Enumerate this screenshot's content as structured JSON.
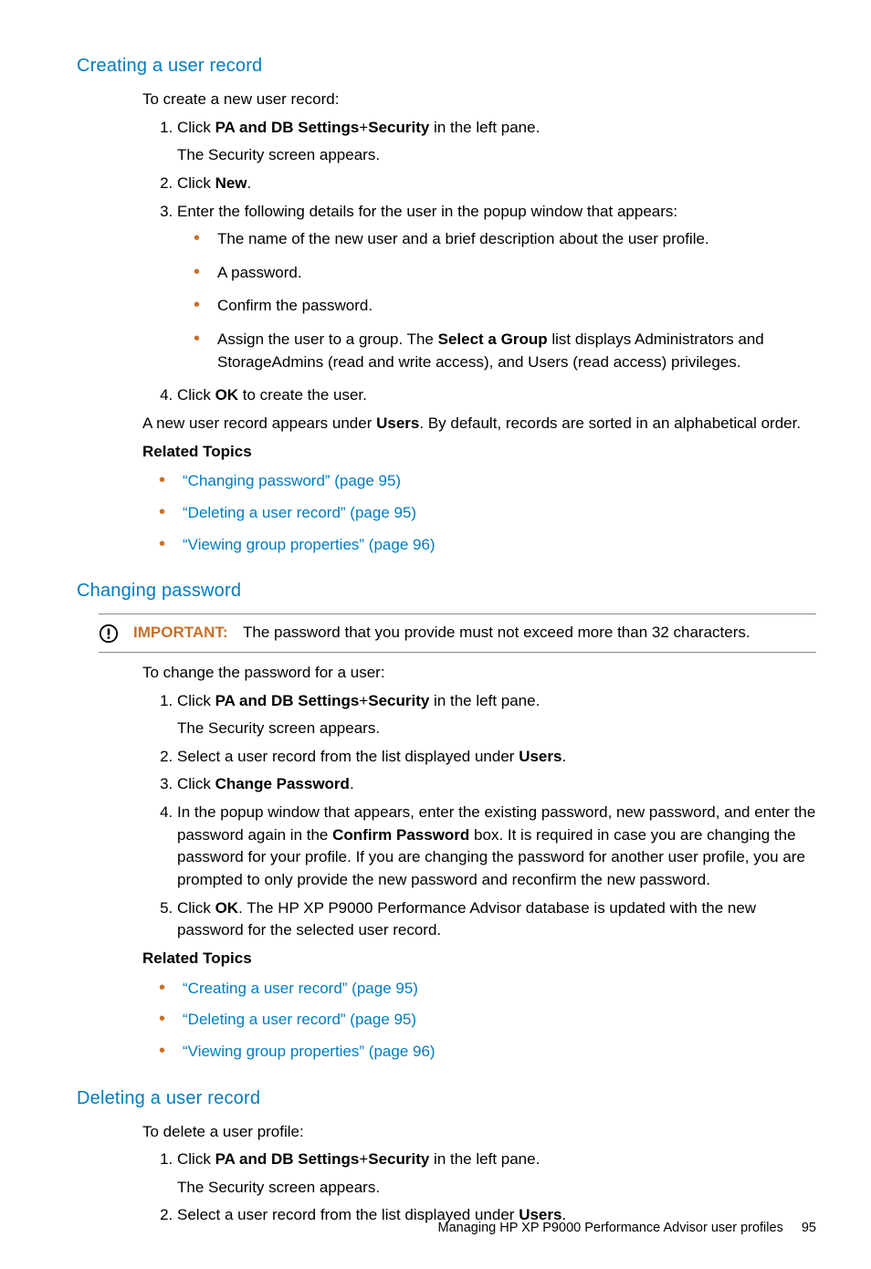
{
  "footer": {
    "text": "Managing HP XP P9000 Performance Advisor user profiles",
    "page": "95"
  },
  "sections": {
    "creating": {
      "heading": "Creating a user record",
      "intro": "To create a new user record:",
      "step1_a": "Click ",
      "step1_b": "PA and DB Settings",
      "step1_c": "+",
      "step1_d": "Security",
      "step1_e": " in the left pane.",
      "step1_sub": "The Security screen appears.",
      "step2_a": "Click ",
      "step2_b": "New",
      "step2_c": ".",
      "step3": "Enter the following details for the user in the popup window that appears:",
      "bullets": {
        "b1": "The name of the new user and a brief description about the user profile.",
        "b2": "A password.",
        "b3": "Confirm the password.",
        "b4_a": "Assign the user to a group. The ",
        "b4_b": "Select a Group",
        "b4_c": " list displays Administrators and StorageAdmins (read and write access), and Users (read access) privileges."
      },
      "step4_a": "Click ",
      "step4_b": "OK",
      "step4_c": " to create the user.",
      "after_a": "A new user record appears under ",
      "after_b": "Users",
      "after_c": ". By default, records are sorted in an alphabetical order.",
      "related_heading": "Related Topics",
      "related": {
        "r1": "“Changing password” (page 95)",
        "r2": "“Deleting a user record” (page 95)",
        "r3": "“Viewing group properties” (page 96)"
      }
    },
    "changing": {
      "heading": "Changing password",
      "important_label": "IMPORTANT:",
      "important_text": "The password that you provide must not exceed more than 32 characters.",
      "intro": "To change the password for a user:",
      "step1_a": "Click ",
      "step1_b": "PA and DB Settings",
      "step1_c": "+",
      "step1_d": "Security",
      "step1_e": " in the left pane.",
      "step1_sub": "The Security screen appears.",
      "step2_a": "Select a user record from the list displayed under ",
      "step2_b": "Users",
      "step2_c": ".",
      "step3_a": "Click ",
      "step3_b": "Change Password",
      "step3_c": ".",
      "step4_a": "In the popup window that appears, enter the existing password, new password, and enter the password again in the ",
      "step4_b": "Confirm Password",
      "step4_c": " box. It is required in case you are changing the password for your profile. If you are changing the password for another user profile, you are prompted to only provide the new password and reconfirm the new password.",
      "step5_a": "Click ",
      "step5_b": "OK",
      "step5_c": ". The HP XP P9000 Performance Advisor database is updated with the new password for the selected user record.",
      "related_heading": "Related Topics",
      "related": {
        "r1": "“Creating a user record” (page 95)",
        "r2": "“Deleting a user record” (page 95)",
        "r3": "“Viewing group properties” (page 96)"
      }
    },
    "deleting": {
      "heading": "Deleting a user record",
      "intro": "To delete a user profile:",
      "step1_a": "Click ",
      "step1_b": "PA and DB Settings",
      "step1_c": "+",
      "step1_d": "Security",
      "step1_e": " in the left pane.",
      "step1_sub": "The Security screen appears.",
      "step2_a": "Select a user record from the list displayed under ",
      "step2_b": "Users",
      "step2_c": "."
    }
  }
}
